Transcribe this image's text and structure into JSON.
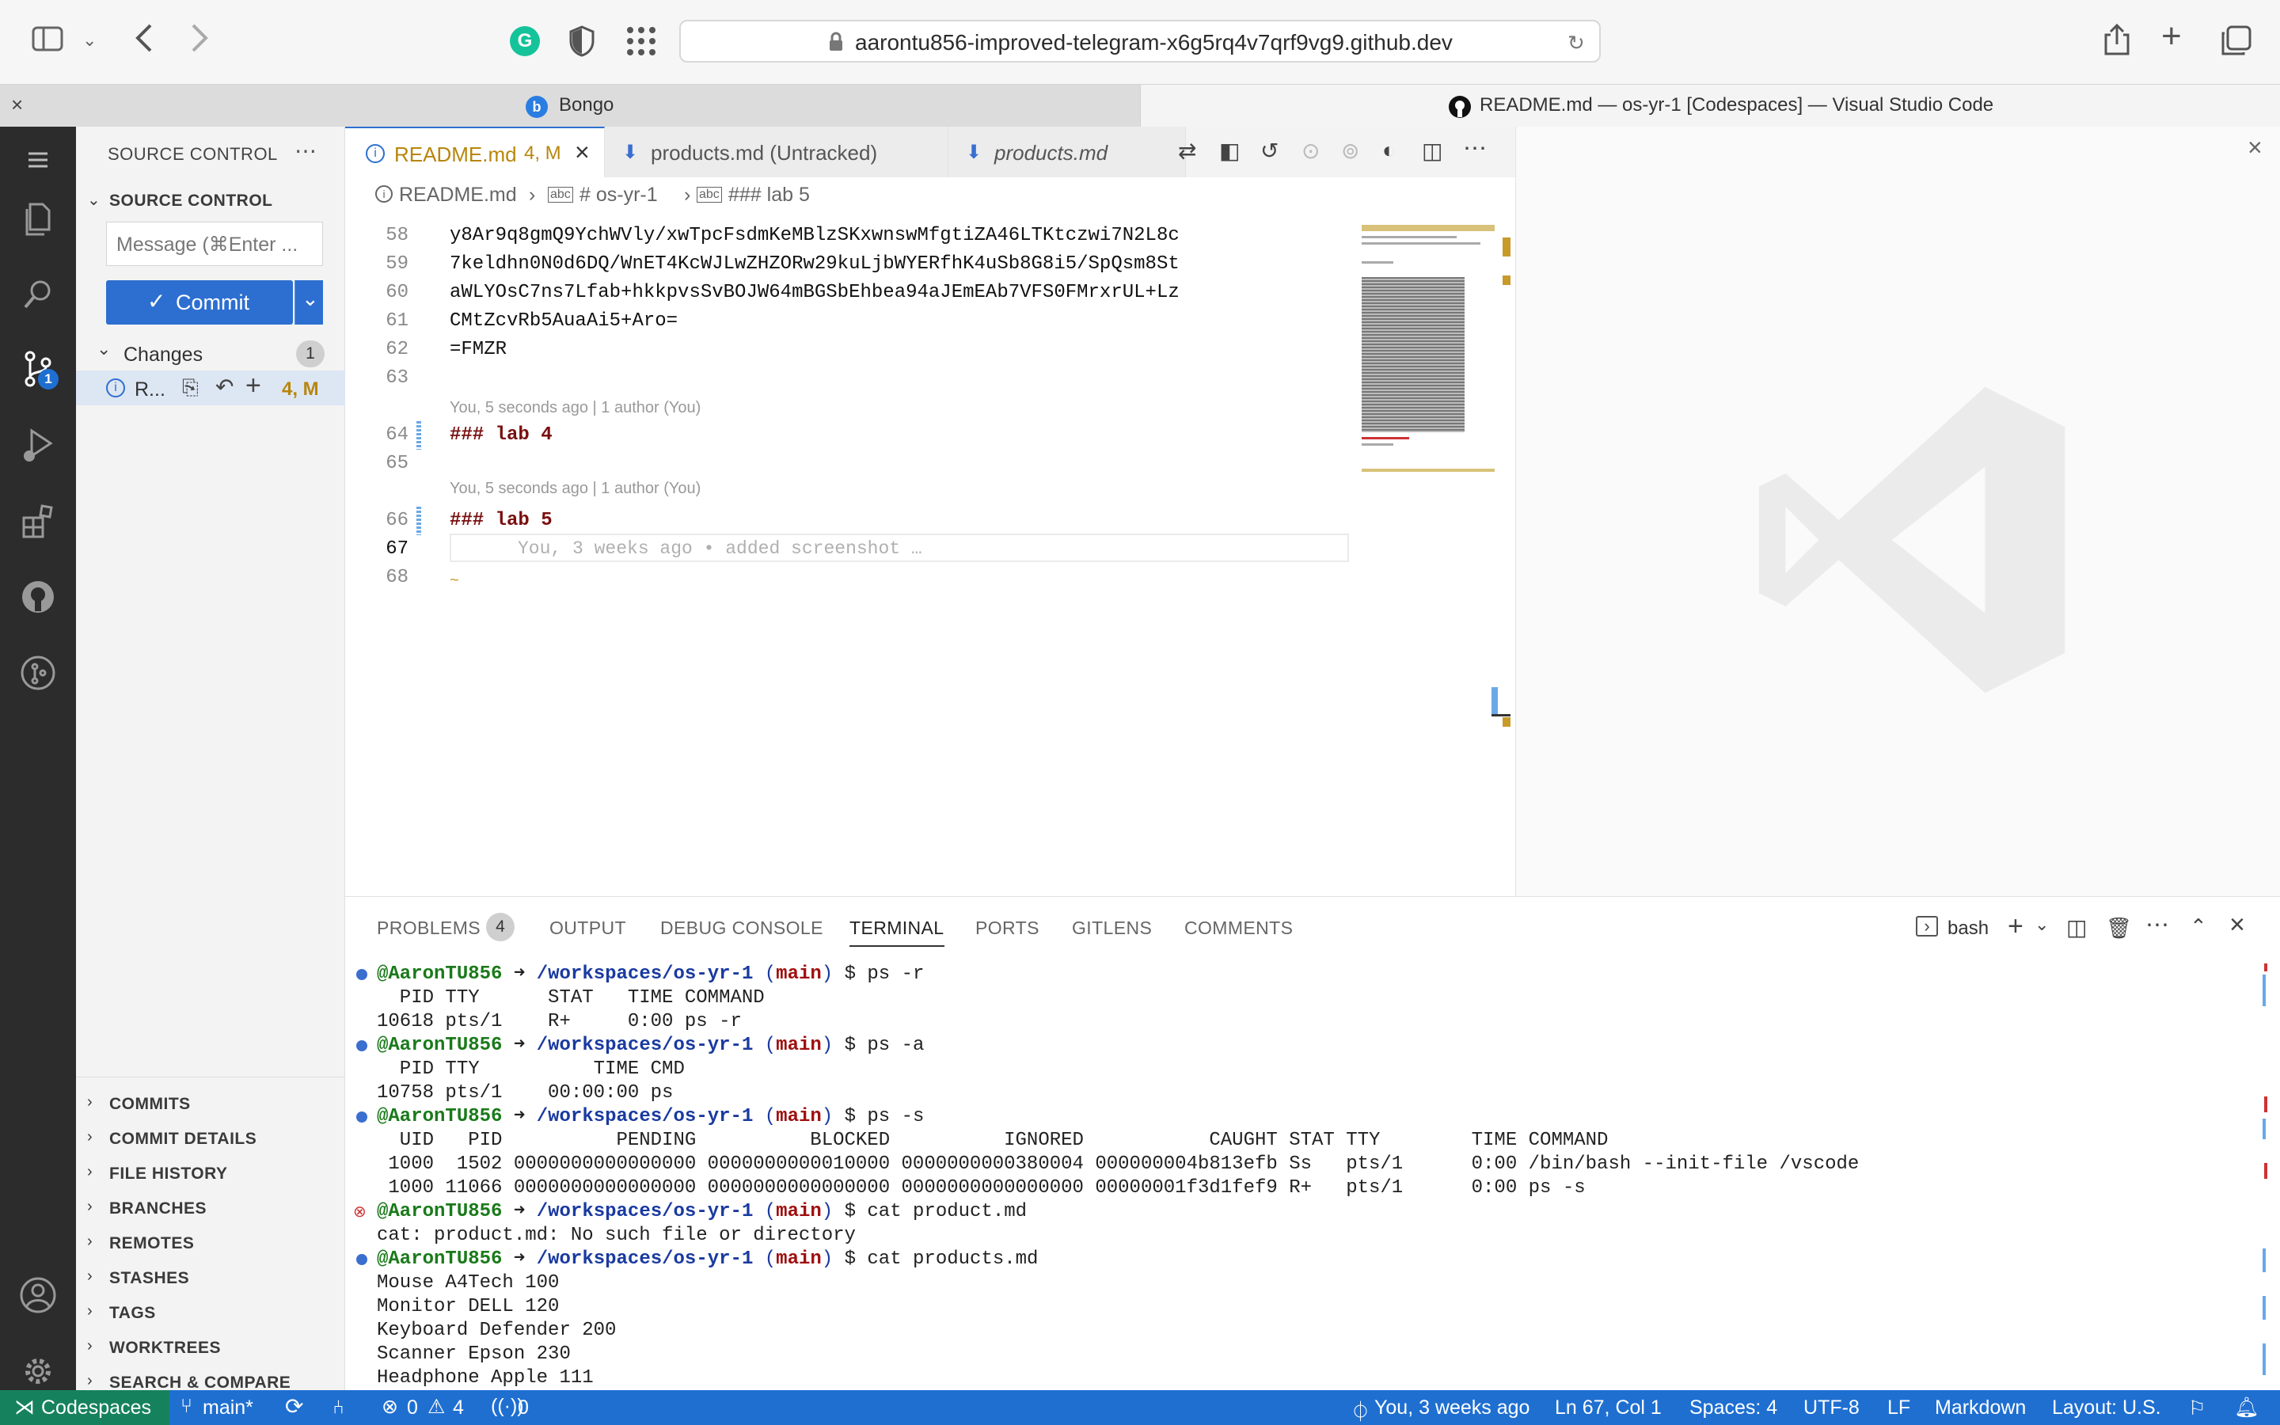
{
  "browser": {
    "url": "aarontu856-improved-telegram-x6g5rq4v7qrf9vg9.github.dev",
    "tabs": [
      {
        "title": "Bongo"
      },
      {
        "title": "README.md — os-yr-1 [Codespaces] — Visual Studio Code"
      }
    ]
  },
  "sidebar": {
    "header": "SOURCE CONTROL",
    "section": "SOURCE CONTROL",
    "message_placeholder": "Message (⌘Enter ...",
    "commit_label": "Commit",
    "changes_label": "Changes",
    "changes_count": "1",
    "change_file": "R...",
    "change_status": "4, M",
    "scm_badge": "1",
    "sections": [
      "COMMITS",
      "COMMIT DETAILS",
      "FILE HISTORY",
      "BRANCHES",
      "REMOTES",
      "STASHES",
      "TAGS",
      "WORKTREES",
      "SEARCH & COMPARE"
    ]
  },
  "editor": {
    "tabs": [
      {
        "label": "README.md",
        "status": "4, M"
      },
      {
        "label": "products.md (Untracked)"
      },
      {
        "label": "products.md"
      }
    ],
    "breadcrumb": [
      "README.md",
      "# os-yr-1",
      "### lab 5"
    ],
    "lines": [
      {
        "n": "58",
        "text": "y8Ar9q8gmQ9YchWVly/xwTpcFsdmKeMBlzSKxwnswMfgtiZA46LTKtczwi7N2L8c"
      },
      {
        "n": "59",
        "text": "7keldhn0N0d6DQ/WnET4KcWJLwZHZORw29kuLjbWYERfhK4uSb8G8i5/SpQsm8St"
      },
      {
        "n": "60",
        "text": "aWLYOsC7ns7Lfab+hkkpvsSvBOJW64mBGSbEhbea94aJEmEAb7VFS0FMrxrUL+Lz"
      },
      {
        "n": "61",
        "text": "CMtZcvRb5AuaAi5+Aro="
      },
      {
        "n": "62",
        "text": "=FMZR"
      },
      {
        "n": "63",
        "text": ""
      },
      {
        "n": "64",
        "text": "### lab 4"
      },
      {
        "n": "65",
        "text": ""
      },
      {
        "n": "66",
        "text": "### lab 5"
      },
      {
        "n": "67",
        "text": ""
      },
      {
        "n": "68",
        "text": ""
      }
    ],
    "blame_64": "You, 5 seconds ago | 1 author (You)",
    "blame_66": "You, 5 seconds ago | 1 author (You)",
    "inline_blame": "You, 3 weeks ago • added screenshot …"
  },
  "panel": {
    "tabs": [
      "PROBLEMS",
      "OUTPUT",
      "DEBUG CONSOLE",
      "TERMINAL",
      "PORTS",
      "GITLENS",
      "COMMENTS"
    ],
    "problems_count": "4",
    "shell": "bash",
    "prompt": {
      "user": "@AaronTU856",
      "arrow": "➜",
      "path": "/workspaces/os-yr-1",
      "branch": "main"
    },
    "terminal": [
      {
        "cmd": "ps -r",
        "ok": true,
        "out": [
          "  PID TTY      STAT   TIME COMMAND",
          "10618 pts/1    R+     0:00 ps -r"
        ]
      },
      {
        "cmd": "ps -a",
        "ok": true,
        "out": [
          "  PID TTY          TIME CMD",
          "10758 pts/1    00:00:00 ps"
        ]
      },
      {
        "cmd": "ps -s",
        "ok": true,
        "out": [
          "  UID   PID          PENDING          BLOCKED          IGNORED           CAUGHT STAT TTY        TIME COMMAND",
          " 1000  1502 0000000000000000 0000000000010000 0000000000380004 000000004b813efb Ss   pts/1      0:00 /bin/bash --init-file /vscode",
          " 1000 11066 0000000000000000 0000000000000000 0000000000000000 00000001f3d1fef9 R+   pts/1      0:00 ps -s"
        ]
      },
      {
        "cmd": "cat product.md",
        "ok": false,
        "out": [
          "cat: product.md: No such file or directory"
        ]
      },
      {
        "cmd": "cat products.md",
        "ok": true,
        "out": [
          "Mouse A4Tech 100",
          "Monitor DELL 120",
          "Keyboard Defender 200",
          "Scanner Epson 230",
          "Headphone Apple 111"
        ]
      },
      {
        "cmd": "",
        "ok": null,
        "out": []
      }
    ]
  },
  "statusbar": {
    "remote": "Codespaces",
    "branch": "main*",
    "errors": "0",
    "warnings": "4",
    "ports": "0",
    "blame": "You, 3 weeks ago",
    "position": "Ln 67, Col 1",
    "spaces": "Spaces: 4",
    "encoding": "UTF-8",
    "eol": "LF",
    "language": "Markdown",
    "layout": "Layout: U.S."
  },
  "colors": {
    "accent": "#1f6fd1",
    "commit_button": "#2d6fd0",
    "modified": "#b8860b"
  }
}
